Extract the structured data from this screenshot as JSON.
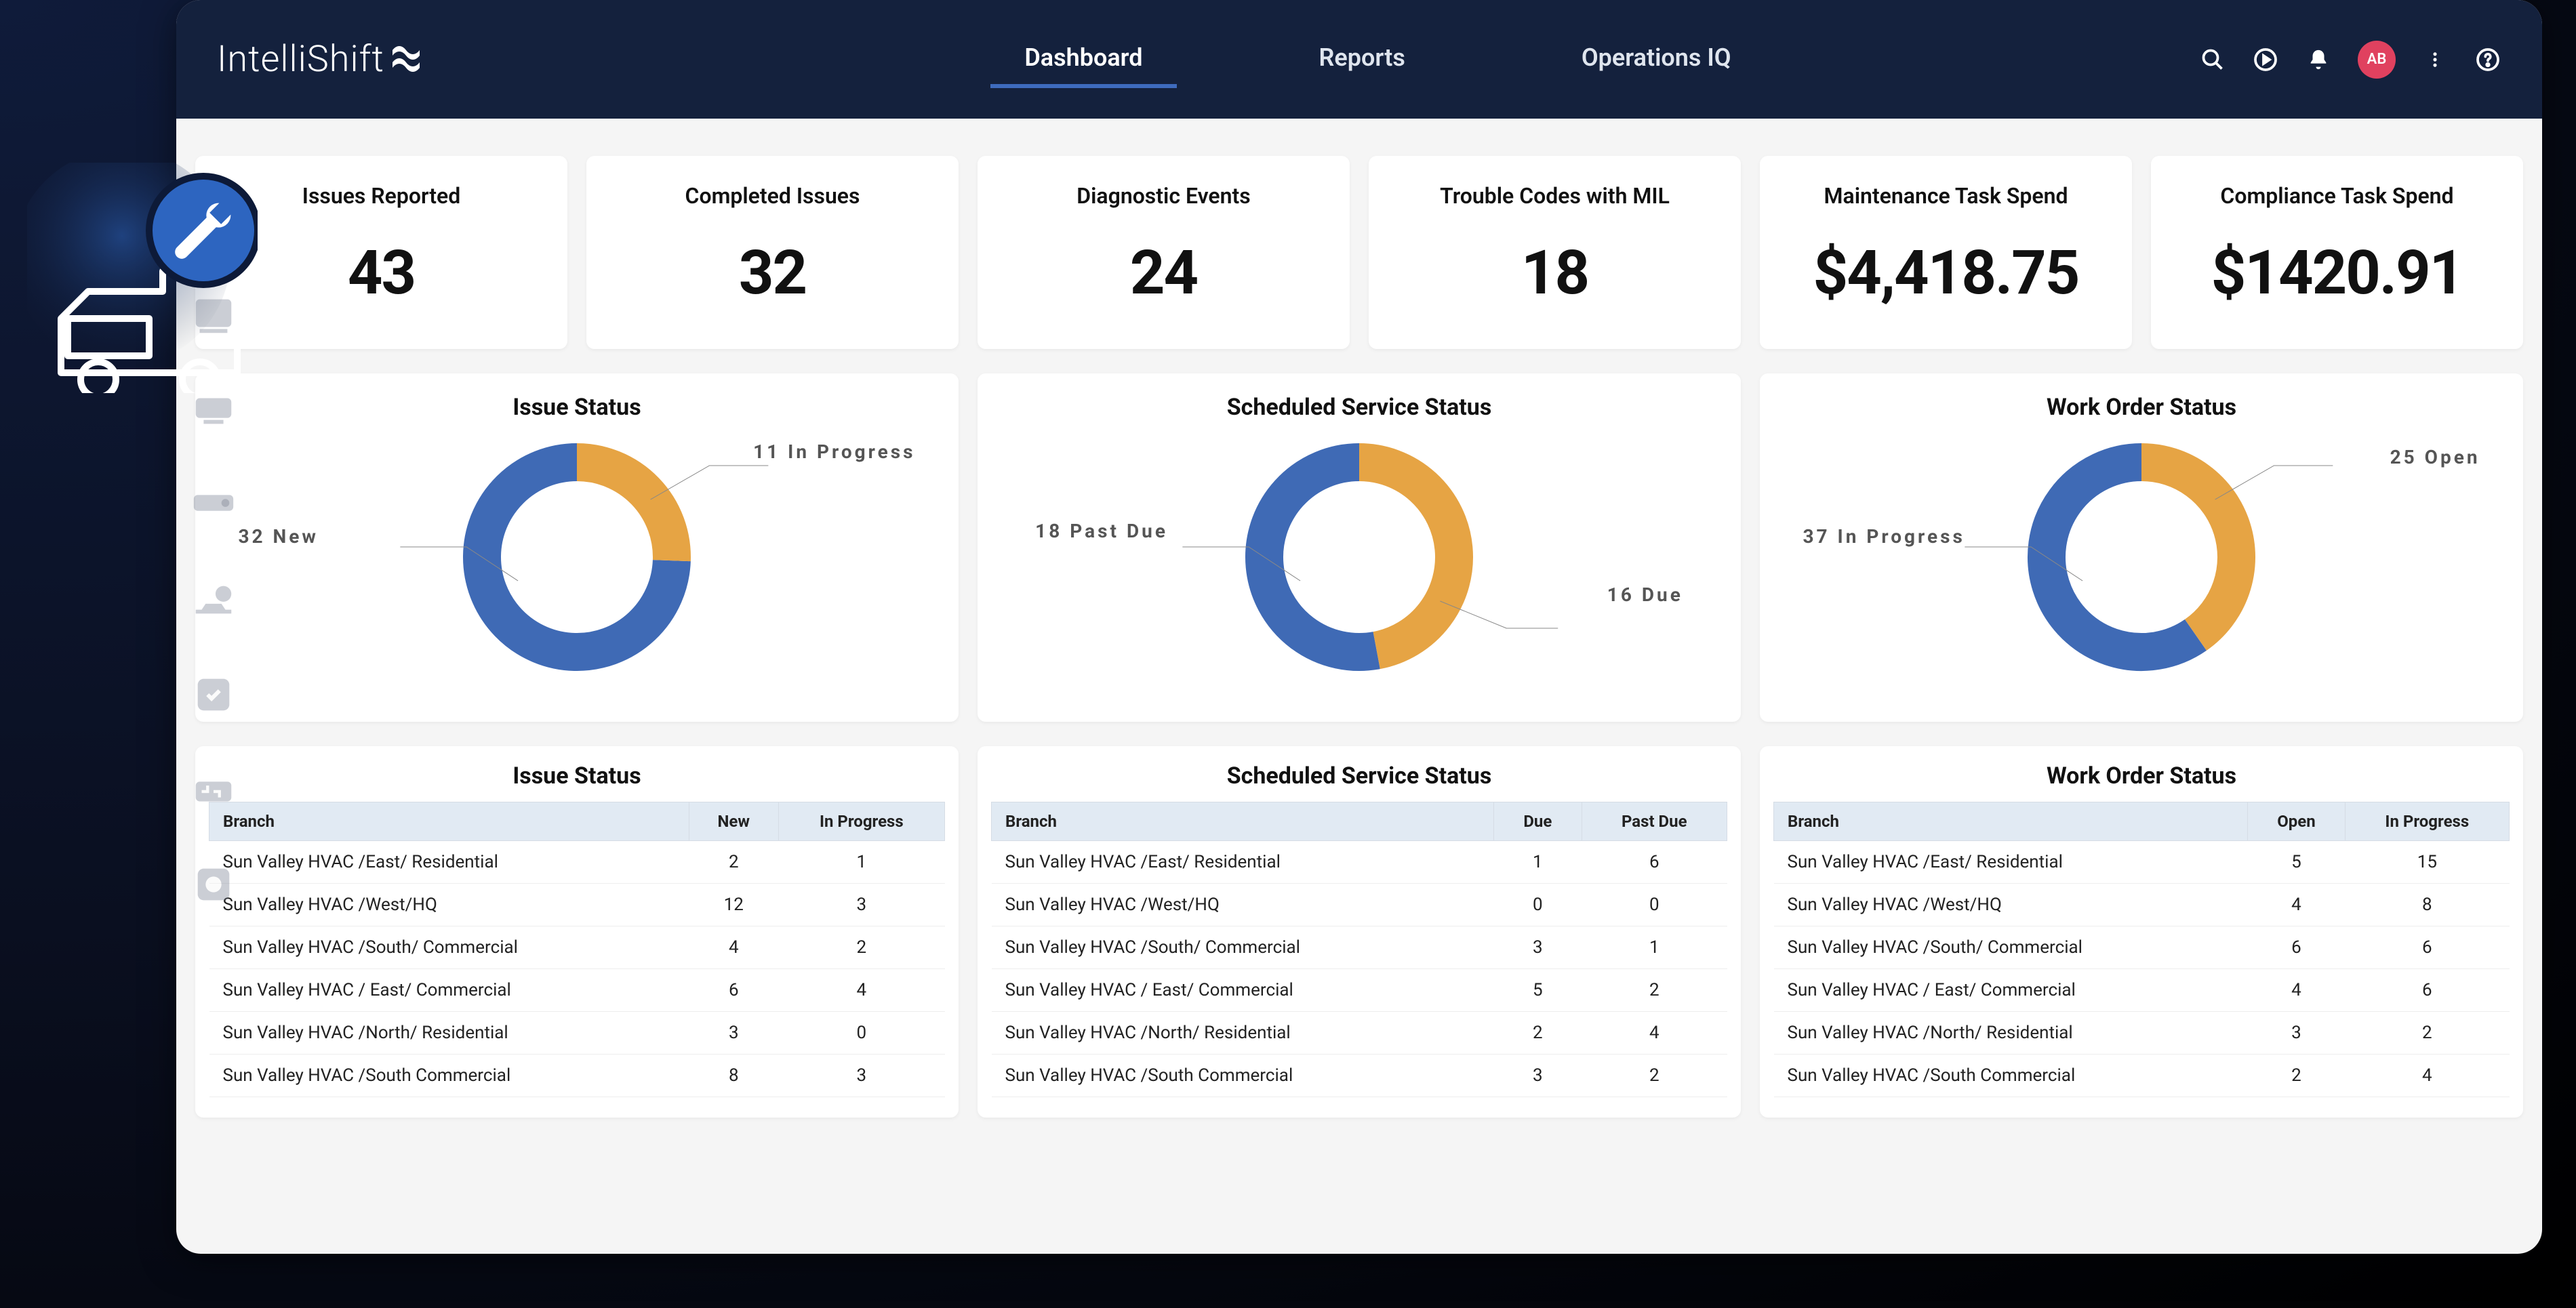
{
  "brand": {
    "name": "IntelliShift"
  },
  "nav": {
    "tabs": [
      {
        "label": "Dashboard",
        "active": true
      },
      {
        "label": "Reports",
        "active": false
      },
      {
        "label": "Operations IQ",
        "active": false
      }
    ]
  },
  "user": {
    "initials": "AB"
  },
  "kpis": [
    {
      "label": "Issues Reported",
      "value": "43"
    },
    {
      "label": "Completed Issues",
      "value": "32"
    },
    {
      "label": "Diagnostic Events",
      "value": "24"
    },
    {
      "label": "Trouble Codes with MIL",
      "value": "18"
    },
    {
      "label": "Maintenance Task Spend",
      "value": "$4,418.75"
    },
    {
      "label": "Compliance Task Spend",
      "value": "$1420.91"
    }
  ],
  "donutCharts": [
    {
      "title": "Issue Status",
      "left": {
        "text": "32 New",
        "value": 32,
        "color": "#3f6ab5"
      },
      "right": {
        "text": "11 In Progress",
        "value": 11,
        "color": "#e6a444"
      }
    },
    {
      "title": "Scheduled Service Status",
      "left": {
        "text": "18 Past Due",
        "value": 18,
        "color": "#3f6ab5"
      },
      "right": {
        "text": "16 Due",
        "value": 16,
        "color": "#e6a444"
      }
    },
    {
      "title": "Work Order Status",
      "left": {
        "text": "37 In Progress",
        "value": 37,
        "color": "#3f6ab5"
      },
      "right": {
        "text": "25 Open",
        "value": 25,
        "color": "#e6a444"
      }
    }
  ],
  "tables": [
    {
      "title": "Issue Status",
      "columns": [
        "Branch",
        "New",
        "In Progress"
      ],
      "rows": [
        [
          "Sun Valley HVAC /East/ Residential",
          "2",
          "1"
        ],
        [
          "Sun Valley HVAC /West/HQ",
          "12",
          "3"
        ],
        [
          "Sun Valley HVAC /South/ Commercial",
          "4",
          "2"
        ],
        [
          "Sun Valley HVAC / East/ Commercial",
          "6",
          "4"
        ],
        [
          "Sun Valley HVAC /North/ Residential",
          "3",
          "0"
        ],
        [
          "Sun Valley HVAC /South Commercial",
          "8",
          "3"
        ]
      ]
    },
    {
      "title": "Scheduled Service Status",
      "columns": [
        "Branch",
        "Due",
        "Past Due"
      ],
      "rows": [
        [
          "Sun Valley HVAC /East/ Residential",
          "1",
          "6"
        ],
        [
          "Sun Valley HVAC /West/HQ",
          "0",
          "0"
        ],
        [
          "Sun Valley HVAC /South/ Commercial",
          "3",
          "1"
        ],
        [
          "Sun Valley HVAC / East/ Commercial",
          "5",
          "2"
        ],
        [
          "Sun Valley HVAC /North/ Residential",
          "2",
          "4"
        ],
        [
          "Sun Valley HVAC /South Commercial",
          "3",
          "2"
        ]
      ]
    },
    {
      "title": "Work Order Status",
      "columns": [
        "Branch",
        "Open",
        "In Progress"
      ],
      "rows": [
        [
          "Sun Valley HVAC /East/ Residential",
          "5",
          "15"
        ],
        [
          "Sun Valley HVAC /West/HQ",
          "4",
          "8"
        ],
        [
          "Sun Valley HVAC /South/ Commercial",
          "6",
          "6"
        ],
        [
          "Sun Valley HVAC / East/ Commercial",
          "4",
          "6"
        ],
        [
          "Sun Valley HVAC /North/ Residential",
          "3",
          "2"
        ],
        [
          "Sun Valley HVAC /South Commercial",
          "2",
          "4"
        ]
      ]
    }
  ],
  "chart_data": [
    {
      "type": "pie",
      "title": "Issue Status",
      "series": [
        {
          "name": "New",
          "value": 32,
          "color": "#3f6ab5"
        },
        {
          "name": "In Progress",
          "value": 11,
          "color": "#e6a444"
        }
      ]
    },
    {
      "type": "pie",
      "title": "Scheduled Service Status",
      "series": [
        {
          "name": "Past Due",
          "value": 18,
          "color": "#3f6ab5"
        },
        {
          "name": "Due",
          "value": 16,
          "color": "#e6a444"
        }
      ]
    },
    {
      "type": "pie",
      "title": "Work Order Status",
      "series": [
        {
          "name": "In Progress",
          "value": 37,
          "color": "#3f6ab5"
        },
        {
          "name": "Open",
          "value": 25,
          "color": "#e6a444"
        }
      ]
    },
    {
      "type": "table",
      "title": "Issue Status",
      "columns": [
        "Branch",
        "New",
        "In Progress"
      ],
      "rows": [
        [
          "Sun Valley HVAC /East/ Residential",
          2,
          1
        ],
        [
          "Sun Valley HVAC /West/HQ",
          12,
          3
        ],
        [
          "Sun Valley HVAC /South/ Commercial",
          4,
          2
        ],
        [
          "Sun Valley HVAC / East/ Commercial",
          6,
          4
        ],
        [
          "Sun Valley HVAC /North/ Residential",
          3,
          0
        ],
        [
          "Sun Valley HVAC /South Commercial",
          8,
          3
        ]
      ]
    },
    {
      "type": "table",
      "title": "Scheduled Service Status",
      "columns": [
        "Branch",
        "Due",
        "Past Due"
      ],
      "rows": [
        [
          "Sun Valley HVAC /East/ Residential",
          1,
          6
        ],
        [
          "Sun Valley HVAC /West/HQ",
          0,
          0
        ],
        [
          "Sun Valley HVAC /South/ Commercial",
          3,
          1
        ],
        [
          "Sun Valley HVAC / East/ Commercial",
          5,
          2
        ],
        [
          "Sun Valley HVAC /North/ Residential",
          2,
          4
        ],
        [
          "Sun Valley HVAC /South Commercial",
          3,
          2
        ]
      ]
    },
    {
      "type": "table",
      "title": "Work Order Status",
      "columns": [
        "Branch",
        "Open",
        "In Progress"
      ],
      "rows": [
        [
          "Sun Valley HVAC /East/ Residential",
          5,
          15
        ],
        [
          "Sun Valley HVAC /West/HQ",
          4,
          8
        ],
        [
          "Sun Valley HVAC /South/ Commercial",
          6,
          6
        ],
        [
          "Sun Valley HVAC / East/ Commercial",
          4,
          6
        ],
        [
          "Sun Valley HVAC /North/ Residential",
          3,
          2
        ],
        [
          "Sun Valley HVAC /South Commercial",
          2,
          4
        ]
      ]
    }
  ]
}
